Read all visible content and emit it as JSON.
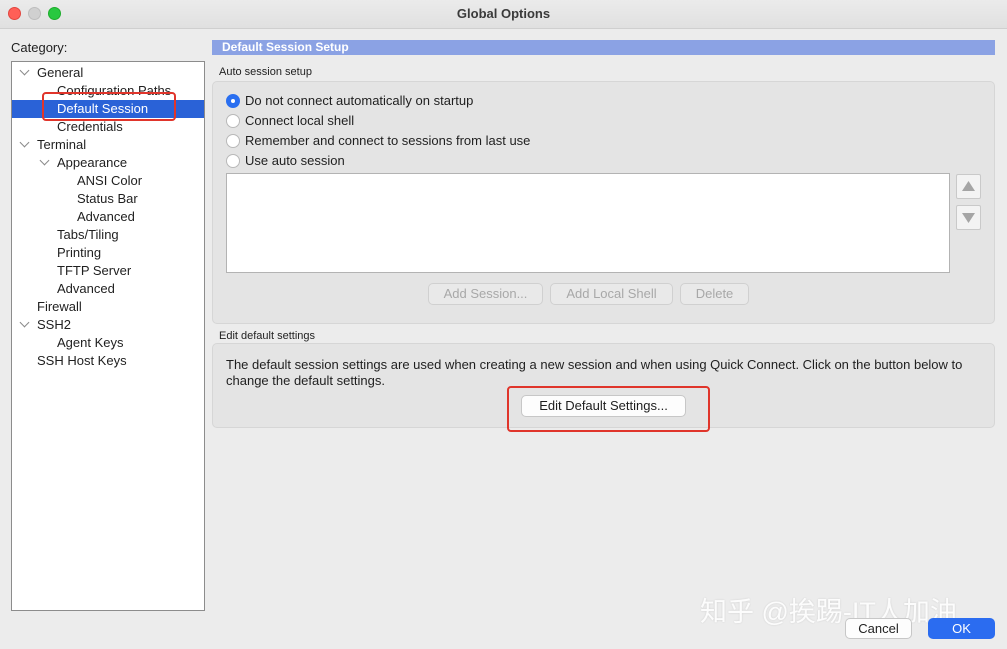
{
  "window": {
    "title": "Global Options"
  },
  "category": {
    "label": "Category:",
    "items": [
      {
        "label": "General",
        "level": 0,
        "expanded": true
      },
      {
        "label": "Configuration Paths",
        "level": 1
      },
      {
        "label": "Default Session",
        "level": 1,
        "selected": true
      },
      {
        "label": "Credentials",
        "level": 1
      },
      {
        "label": "Terminal",
        "level": 0,
        "expanded": true
      },
      {
        "label": "Appearance",
        "level": 1,
        "expanded": true
      },
      {
        "label": "ANSI Color",
        "level": 2
      },
      {
        "label": "Status Bar",
        "level": 2
      },
      {
        "label": "Advanced",
        "level": 2
      },
      {
        "label": "Tabs/Tiling",
        "level": 1
      },
      {
        "label": "Printing",
        "level": 1
      },
      {
        "label": "TFTP Server",
        "level": 1
      },
      {
        "label": "Advanced",
        "level": 1
      },
      {
        "label": "Firewall",
        "level": 0
      },
      {
        "label": "SSH2",
        "level": 0,
        "expanded": true
      },
      {
        "label": "Agent Keys",
        "level": 1
      },
      {
        "label": "SSH Host Keys",
        "level": 0
      }
    ]
  },
  "section": {
    "title": "Default Session Setup"
  },
  "auto_session": {
    "group_label": "Auto session setup",
    "options": [
      {
        "label": "Do not connect automatically on startup",
        "selected": true
      },
      {
        "label": "Connect local shell",
        "selected": false
      },
      {
        "label": "Remember and connect to sessions from last use",
        "selected": false
      },
      {
        "label": "Use auto session",
        "selected": false
      }
    ],
    "buttons": {
      "add_session": "Add Session...",
      "add_local_shell": "Add Local Shell",
      "delete": "Delete"
    }
  },
  "edit_defaults": {
    "group_label": "Edit default settings",
    "description": "The default session settings are used when creating a new session and when using Quick Connect.  Click on the button below to change the default settings.",
    "button": "Edit Default Settings..."
  },
  "footer": {
    "cancel": "Cancel",
    "ok": "OK"
  },
  "watermark": "知乎 @挨踢-IT人加油",
  "colors": {
    "accent": "#2a62d7",
    "section_header": "#8ba2e4",
    "annotation": "#e0352b"
  }
}
